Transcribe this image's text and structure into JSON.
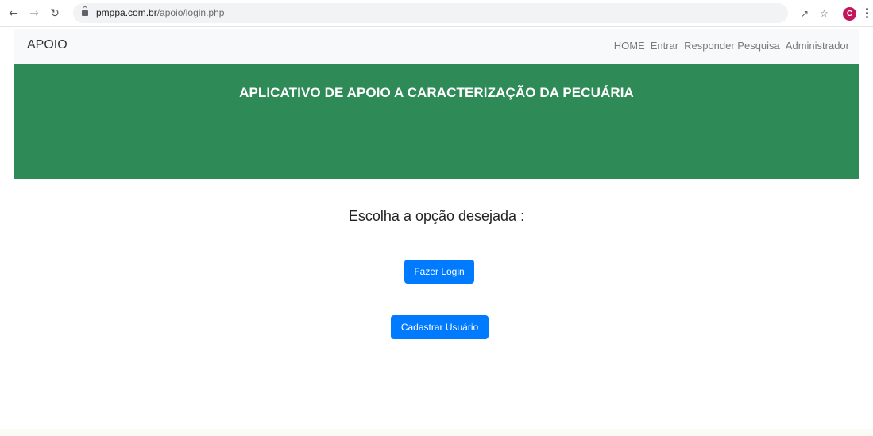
{
  "browser": {
    "url_host": "pmppa.com.br",
    "url_path": "/apoio/login.php",
    "profile_initial": "C",
    "icons": [
      "back-arrow-icon",
      "forward-arrow-icon",
      "reload-icon",
      "lock-icon",
      "share-icon",
      "star-icon",
      "kebab-menu-icon"
    ]
  },
  "navbar": {
    "brand": "APOIO",
    "links": [
      "HOME",
      "Entrar",
      "Responder Pesquisa",
      "Administrador"
    ]
  },
  "hero": {
    "title": "APLICATIVO DE APOIO A CARACTERIZAÇÃO DA PECUÁRIA",
    "bg_color": "#2e8b57"
  },
  "main": {
    "prompt": "Escolha a opção desejada :",
    "login_label": "Fazer Login",
    "register_label": "Cadastrar Usuário",
    "button_color": "#007bff"
  }
}
